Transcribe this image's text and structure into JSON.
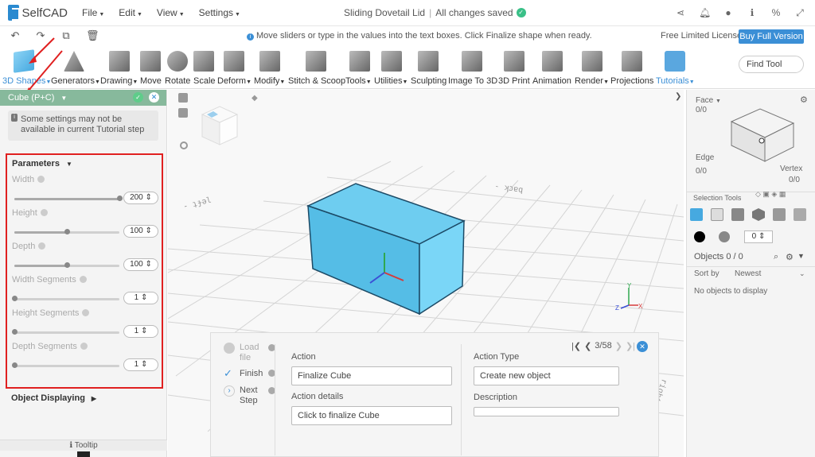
{
  "app": {
    "logo_text": "SelfCAD",
    "menus": [
      "File",
      "Edit",
      "View",
      "Settings"
    ],
    "project_title": "Sliding Dovetail Lid",
    "save_status": "All changes saved"
  },
  "hint": "Move sliders or type in the values into the text boxes. Click Finalize shape when ready.",
  "license": {
    "text": "Free Limited License",
    "buy_label": "Buy Full Version"
  },
  "toolbar": {
    "tools": [
      {
        "label": "3D Shapes",
        "icon": "cube-icon"
      },
      {
        "label": "Generators",
        "icon": "generators-icon"
      },
      {
        "label": "Drawing",
        "icon": "drawing-icon"
      },
      {
        "label": "Move",
        "icon": "move-icon"
      },
      {
        "label": "Rotate",
        "icon": "rotate-icon"
      },
      {
        "label": "Scale",
        "icon": "scale-icon"
      },
      {
        "label": "Deform",
        "icon": "deform-icon"
      },
      {
        "label": "Modify",
        "icon": "modify-icon"
      },
      {
        "label": "Stitch & Scoop",
        "icon": "stitch-icon"
      },
      {
        "label": "Tools",
        "icon": "tools-icon"
      },
      {
        "label": "Utilities",
        "icon": "utilities-icon"
      },
      {
        "label": "Sculpting",
        "icon": "sculpting-icon"
      },
      {
        "label": "Image To 3D",
        "icon": "image-icon"
      },
      {
        "label": "3D Print",
        "icon": "print-icon"
      },
      {
        "label": "Animation",
        "icon": "animation-icon"
      },
      {
        "label": "Render",
        "icon": "render-icon"
      },
      {
        "label": "Projections",
        "icon": "projections-icon"
      },
      {
        "label": "Tutorials",
        "icon": "tutorials-icon"
      }
    ],
    "find_tool": "Find Tool"
  },
  "left_panel": {
    "header": "Cube (P+C)",
    "warning": "Some settings may not be available in current Tutorial step",
    "parameters_title": "Parameters",
    "params": [
      {
        "label": "Width",
        "value": "200",
        "level": 1.0
      },
      {
        "label": "Height",
        "value": "100",
        "level": 0.5
      },
      {
        "label": "Depth",
        "value": "100",
        "level": 0.5
      },
      {
        "label": "Width Segments",
        "value": "1",
        "level": 0.0
      },
      {
        "label": "Height Segments",
        "value": "1",
        "level": 0.0
      },
      {
        "label": "Depth Segments",
        "value": "1",
        "level": 0.0
      }
    ],
    "object_displaying": "Object Displaying",
    "tooltip": "Tooltip"
  },
  "step_panel": {
    "steps": [
      {
        "label": "Load file",
        "state": "pending"
      },
      {
        "label": "Finish",
        "state": "done"
      },
      {
        "label": "Next Step",
        "state": "next"
      }
    ],
    "action_label": "Action",
    "action_value": "Finalize Cube",
    "action_details_label": "Action details",
    "action_details_value": "Click to finalize Cube",
    "action_type_label": "Action Type",
    "action_type_value": "Create new object",
    "description_label": "Description",
    "description_value": "",
    "counter": "3/58"
  },
  "right_panel": {
    "face_label": "Face",
    "face_count": "0/0",
    "edge_label": "Edge",
    "edge_count": "0/0",
    "vertex_label": "Vertex",
    "vertex_count": "0/0",
    "selection_tools": "Selection Tools",
    "color_value": "0",
    "objects_label": "Objects 0 / 0",
    "sort_label": "Sort by",
    "sort_value": "Newest",
    "no_objects": "No objects to display"
  },
  "colors": {
    "accent": "#3b8fd6",
    "cube_fill": "#5ec8ec",
    "panel_header": "#87b99c",
    "highlight_border": "#e02020"
  }
}
